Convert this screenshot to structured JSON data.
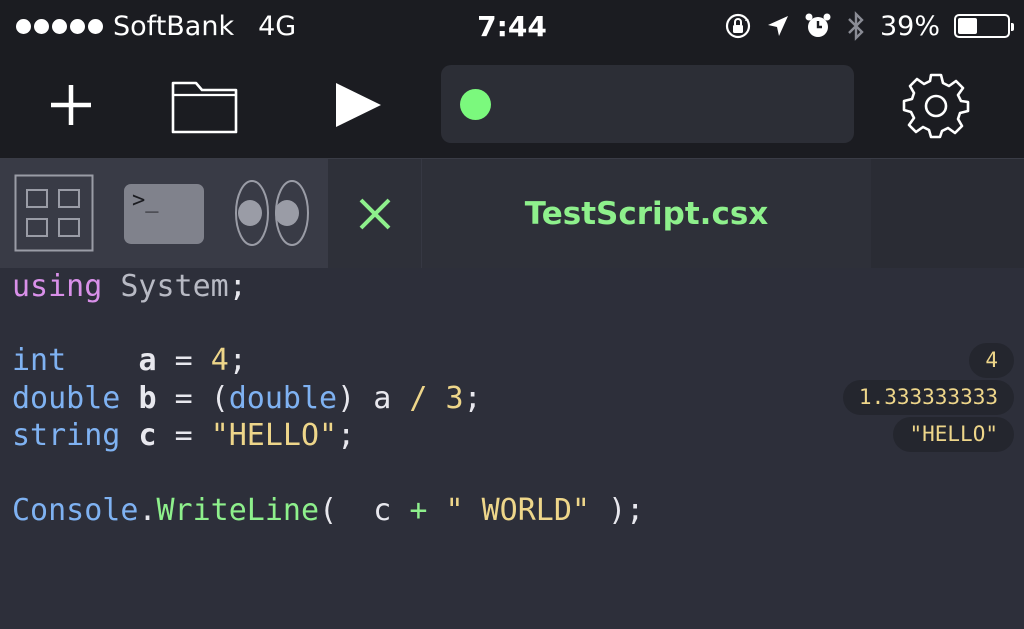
{
  "status_bar": {
    "carrier": "SoftBank",
    "network": "4G",
    "time": "7:44",
    "battery_percent": "39%",
    "battery_level": 0.39,
    "icons": [
      "orientation-lock-icon",
      "location-arrow-icon",
      "alarm-icon",
      "bluetooth-icon"
    ]
  },
  "toolbar": {
    "buttons": [
      "plus-icon",
      "folder-icon",
      "play-icon",
      "gear-icon"
    ],
    "status_indicator_color": "#7bf97d"
  },
  "tabs": {
    "quick_tabs": [
      "grid-icon",
      "terminal-icon",
      "eyes-icon"
    ],
    "terminal_prompt": ">_",
    "file_tab": {
      "title": "TestScript.csx",
      "close_icon": "close-icon"
    }
  },
  "code": {
    "line1": {
      "kw": "using",
      "ns": "System",
      "semi": ";"
    },
    "line3": {
      "type": "int",
      "var": "a",
      "eq": "=",
      "num": "4",
      "semi": ";"
    },
    "line4": {
      "type": "double",
      "var": "b",
      "eq": "=",
      "lp": "(",
      "cast": "double",
      "rp": ")",
      "a": "a",
      "op": "/",
      "num": "3",
      "semi": ";"
    },
    "line5": {
      "type": "string",
      "var": "c",
      "eq": "=",
      "str": "\"HELLO\"",
      "semi": ";"
    },
    "line7": {
      "cls": "Console",
      "dot": ".",
      "fn": "WriteLine",
      "lp": "(",
      "c": "c",
      "op": "+",
      "str": "\" WORLD\"",
      "rp": ")",
      "semi": ";"
    }
  },
  "results": [
    "4",
    "1.333333333",
    "\"HELLO\""
  ],
  "colors": {
    "accent_green": "#8ef08c",
    "keyword": "#d990e9",
    "type": "#7fb2f2",
    "literal": "#eed68a"
  }
}
